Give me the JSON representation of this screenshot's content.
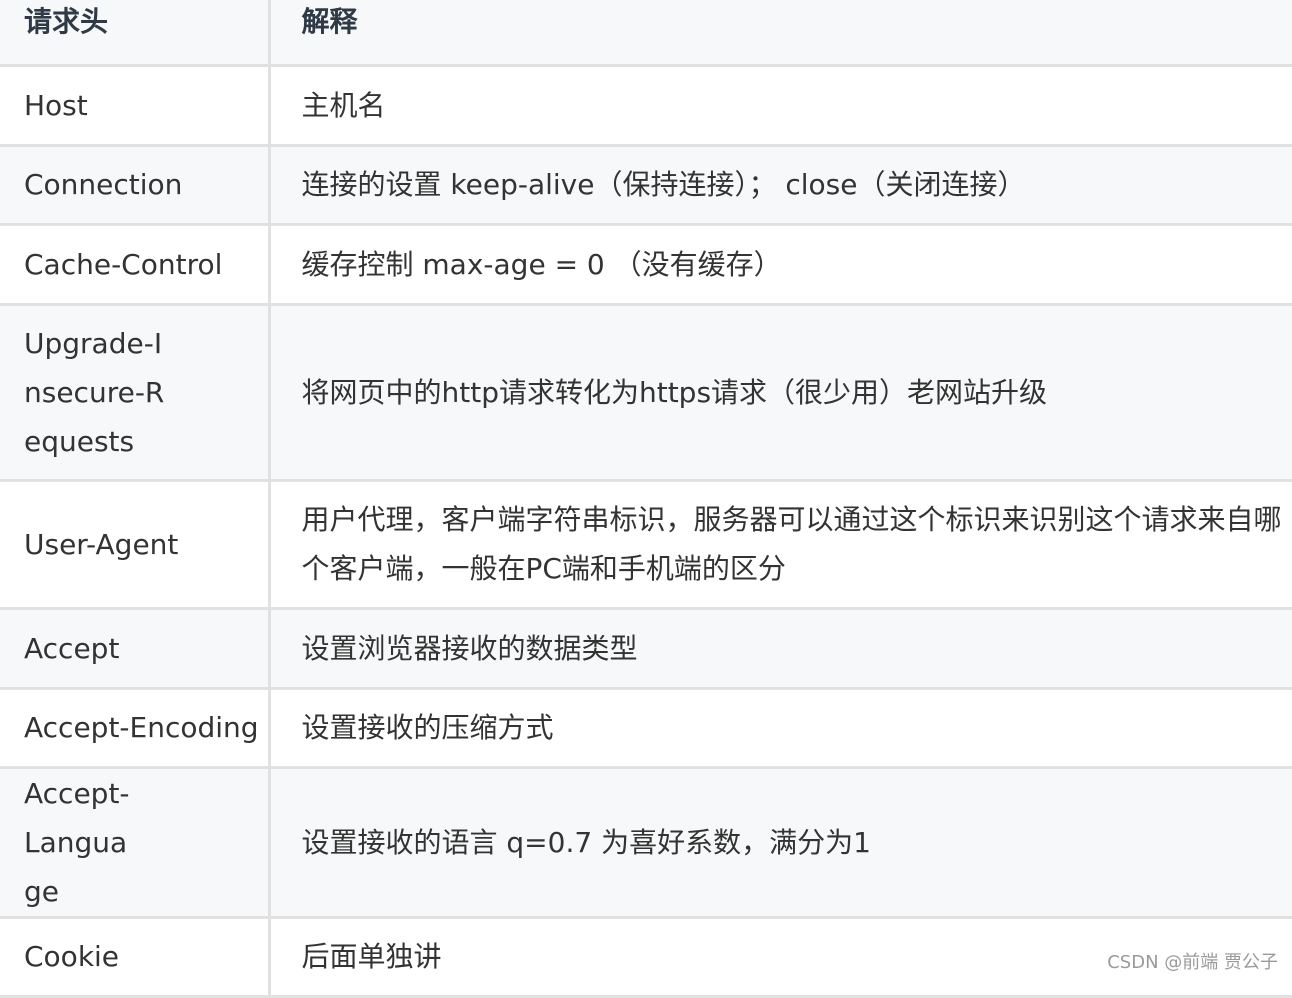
{
  "table": {
    "headers": [
      "请求头",
      "解释"
    ],
    "rows": [
      {
        "header": "Host",
        "description": "主机名"
      },
      {
        "header": "Connection",
        "description": "连接的设置 keep-alive（保持连接）； close（关闭连接）"
      },
      {
        "header": "Cache-Control",
        "description": "缓存控制 max-age = 0 （没有缓存）"
      },
      {
        "header": "Upgrade-Insecure-Requests",
        "description": "将网页中的http请求转化为https请求（很少用）老网站升级"
      },
      {
        "header": "User-Agent",
        "description": "用户代理，客户端字符串标识，服务器可以通过这个标识来识别这个请求来自哪个客户端，一般在PC端和手机端的区分"
      },
      {
        "header": "Accept",
        "description": "设置浏览器接收的数据类型"
      },
      {
        "header": "Accept-Encoding",
        "description": "设置接收的压缩方式"
      },
      {
        "header": "Accept-Language",
        "description": "设置接收的语言 q=0.7 为喜好系数，满分为1"
      },
      {
        "header": "Cookie",
        "description": "后面单独讲"
      }
    ]
  },
  "watermark": "CSDN @前端 贾公子"
}
